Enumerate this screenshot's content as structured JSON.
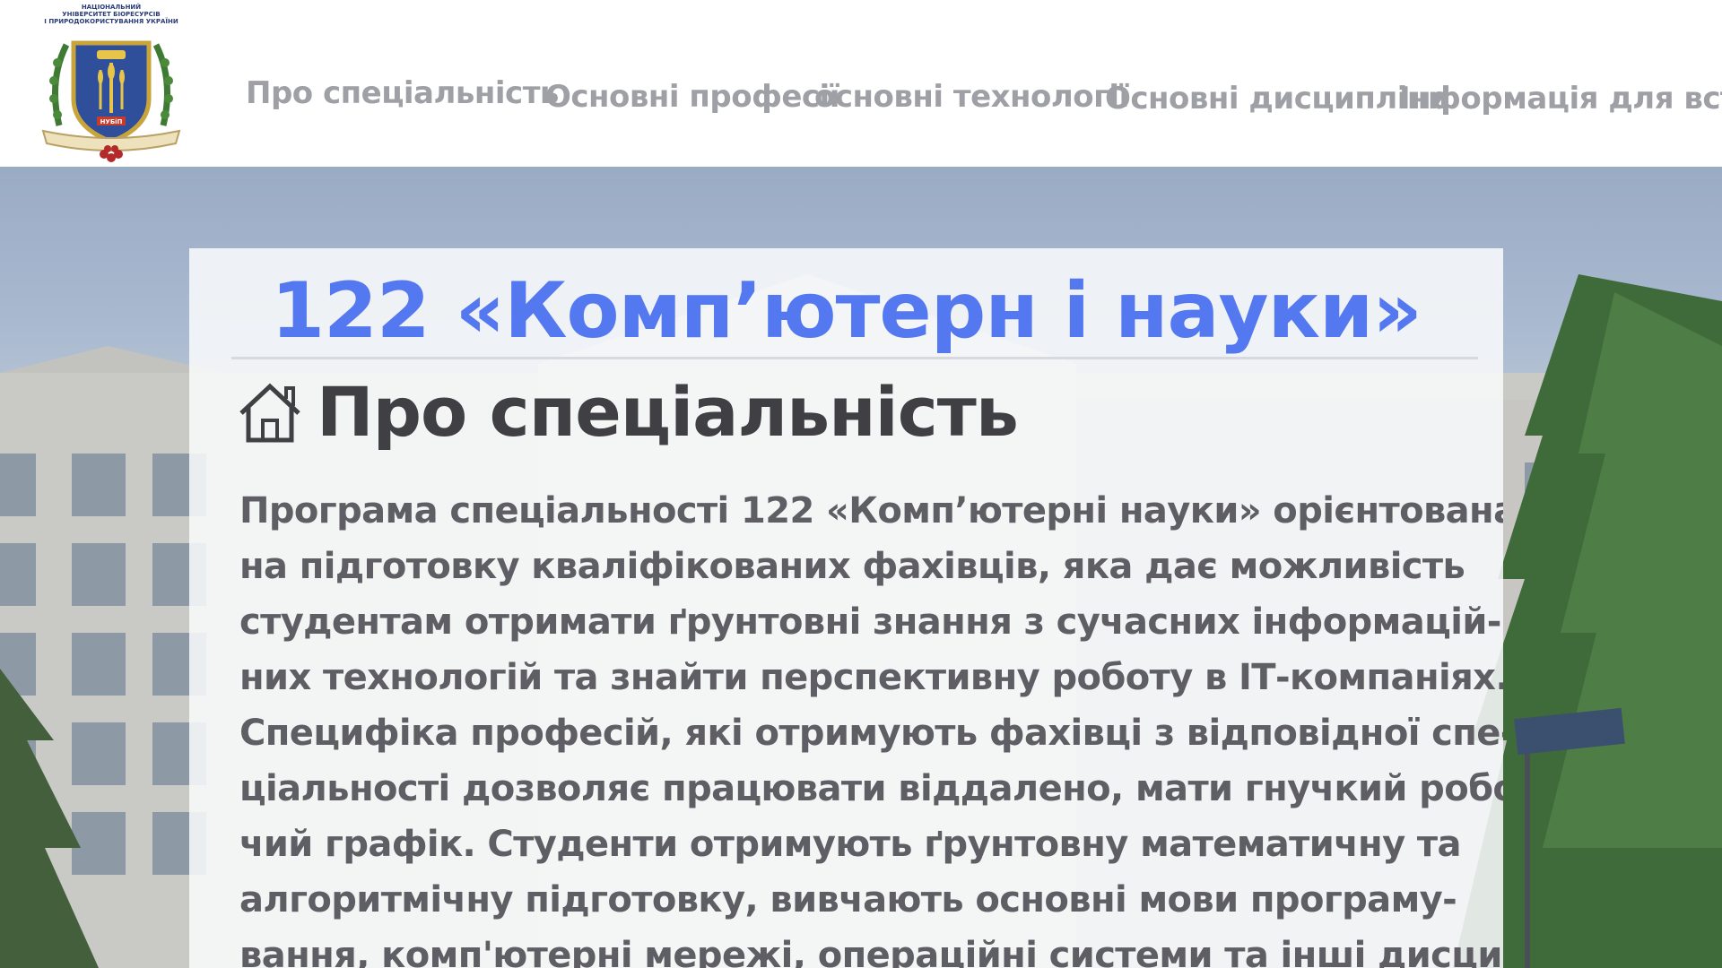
{
  "logo": {
    "caption_lines": [
      "НАЦІОНАЛЬНИЙ",
      "УНІВЕРСИТЕТ БІОРЕСУРСІВ",
      "І ПРИРОДОКОРИСТУВАННЯ УКРАЇНИ"
    ],
    "shield_text": "НУБіП"
  },
  "nav": {
    "items": [
      {
        "label": "Про спеціальність"
      },
      {
        "label": "Основні професії"
      },
      {
        "label": "основні технології"
      },
      {
        "label": "Основні дисципліни"
      },
      {
        "label": "Інформація для вступу"
      }
    ]
  },
  "main": {
    "specialty_title": "122 «Комп’ютерн і  науки»",
    "section_heading": "Про спеціальність",
    "description_lines": [
      "Програма спеціальності 122 «Комп’ютерні науки» орієнтована",
      "на підготовку кваліфікованих фахівців, яка дає можливість",
      "студентам отримати ґрунтовні знання з сучасних інформацій-",
      "них технологій та знайти перспективну роботу в ІТ-компаніях.",
      "Специфіка професій, які отримують фахівці з відповідної спе-",
      "ціальності дозволяє працювати віддалено, мати гнучкий робо-",
      "чий графік. Студенти отримують ґрунтовну математичну та",
      "алгоритмічну підготовку, вивчають основні мови програму-",
      "вання, комп'ютерні мережі, операційні системи та інші дисци-"
    ]
  },
  "colors": {
    "title_blue": "#5478f0",
    "nav_gray": "#9ea0a6",
    "heading_dark": "#3f3f44",
    "body_gray": "#5e5e64"
  },
  "icons": {
    "section_icon": "home-icon"
  }
}
